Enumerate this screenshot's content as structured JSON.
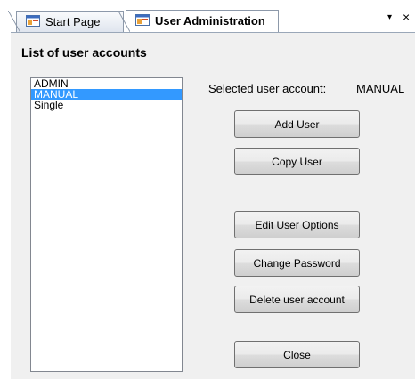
{
  "tabs": [
    {
      "label": "Start Page",
      "active": false,
      "icon": "app-window-icon"
    },
    {
      "label": "User Administration",
      "active": true,
      "icon": "app-window-icon"
    }
  ],
  "tab_controls": {
    "menu_glyph": "▾",
    "close_glyph": "×"
  },
  "main": {
    "heading": "List of user accounts",
    "users": [
      "ADMIN",
      "MANUAL",
      "Single"
    ],
    "selected_user": "MANUAL",
    "selected_label": "Selected user account:",
    "selected_value": "MANUAL",
    "buttons": {
      "add_user": "Add User",
      "copy_user": "Copy User",
      "edit_options": "Edit User Options",
      "change_password": "Change Password",
      "delete_account": "Delete user account",
      "close": "Close"
    }
  },
  "colors": {
    "selection": "#3399ff",
    "panel": "#f0f0f0"
  }
}
